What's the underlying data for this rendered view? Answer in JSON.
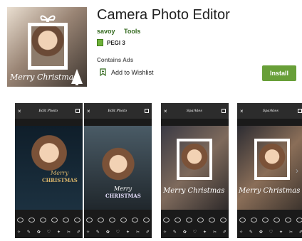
{
  "app": {
    "title": "Camera Photo Editor",
    "developer": "savoy",
    "category": "Tools",
    "rating_label": "PEGI 3",
    "ads_label": "Contains Ads",
    "wishlist_label": "Add to Wishlist",
    "install_label": "Install",
    "icon_text": "Merry Christmas"
  },
  "colors": {
    "accent_green": "#689f38",
    "link_green": "#33691e",
    "pegi_green": "#6fb23a"
  },
  "screenshots": [
    {
      "header": "Edit Photo",
      "overlay_line1": "Merry",
      "overlay_line2": "CHRISTMAS"
    },
    {
      "header": "Edit Photo",
      "overlay_line1": "Merry",
      "overlay_line2": "CHRISTMAS"
    },
    {
      "header": "Sparkles",
      "overlay_line1": "Merry Christmas",
      "overlay_line2": ""
    },
    {
      "header": "Sparkles",
      "overlay_line1": "Merry Christmas",
      "overlay_line2": ""
    }
  ],
  "icons": {
    "close": "×",
    "next": "›"
  }
}
